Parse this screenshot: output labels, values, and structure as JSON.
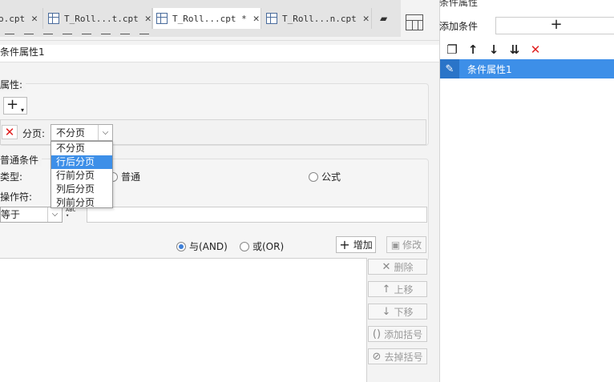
{
  "tabs": [
    {
      "label": "o.cpt",
      "close": "✕",
      "active": false
    },
    {
      "label": "T_Roll...t.cpt",
      "close": "✕",
      "active": false
    },
    {
      "label": "T_Roll...cpt *",
      "close": "✕",
      "active": true
    },
    {
      "label": "T_Roll...n.cpt",
      "close": "✕",
      "active": false
    }
  ],
  "right_panel": {
    "title": "条件属性",
    "add_condition_label": "添加条件",
    "add_button_label": "+",
    "toolbar_icons": [
      "copy-icon",
      "arrow-up-icon",
      "arrow-down-icon",
      "move-bottom-icon",
      "delete-icon"
    ],
    "items": [
      {
        "label": "条件属性1",
        "selected": true
      }
    ]
  },
  "dialog": {
    "title": "条件属性1",
    "property_label": "属性:",
    "plus_label": "+",
    "plus_caret": "▾",
    "page_label": "分页:",
    "page_value": "不分页",
    "dropdown_options": [
      "不分页",
      "行后分页",
      "行前分页",
      "列后分页",
      "列前分页"
    ],
    "dropdown_selected_index": 1,
    "normal_condition_label": "普通条件",
    "type_label": "类型:",
    "type_normal": "普通",
    "type_formula": "公式",
    "operator_label": "操作符:",
    "operator_value": "等于",
    "value_text": "",
    "and_label": "与(AND)",
    "or_label": "或(OR)",
    "logic_selected": "and",
    "add_label": "增加",
    "edit_label": "修改",
    "side_buttons": [
      {
        "label": "删除",
        "icon": "✕"
      },
      {
        "label": "上移",
        "icon": "↑"
      },
      {
        "label": "下移",
        "icon": "↓"
      },
      {
        "label": "添加括号",
        "icon": "()"
      },
      {
        "label": "去掉括号",
        "icon": "⊘"
      }
    ]
  }
}
